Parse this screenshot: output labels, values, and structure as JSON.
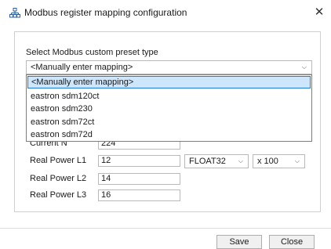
{
  "window": {
    "title": "Modbus register mapping configuration",
    "icon": "network-icon",
    "close_glyph": "✕"
  },
  "preset": {
    "label": "Select Modbus custom preset type",
    "selected": "<Manually enter mapping>",
    "options": [
      "<Manually enter mapping>",
      "eastron sdm120ct",
      "eastron sdm230",
      "eastron sdm72ct",
      "eastron sdm72d"
    ]
  },
  "rows": [
    {
      "label": "Current N",
      "value": "224"
    },
    {
      "label": "Real Power L1",
      "value": "12",
      "type": "FLOAT32",
      "multiplier": "x 100"
    },
    {
      "label": "Real Power L2",
      "value": "14"
    },
    {
      "label": "Real Power L3",
      "value": "16"
    }
  ],
  "buttons": {
    "save": "Save",
    "close": "Close"
  },
  "colors": {
    "selection_bg": "#cde6fb",
    "selection_border": "#1e7bd6"
  }
}
